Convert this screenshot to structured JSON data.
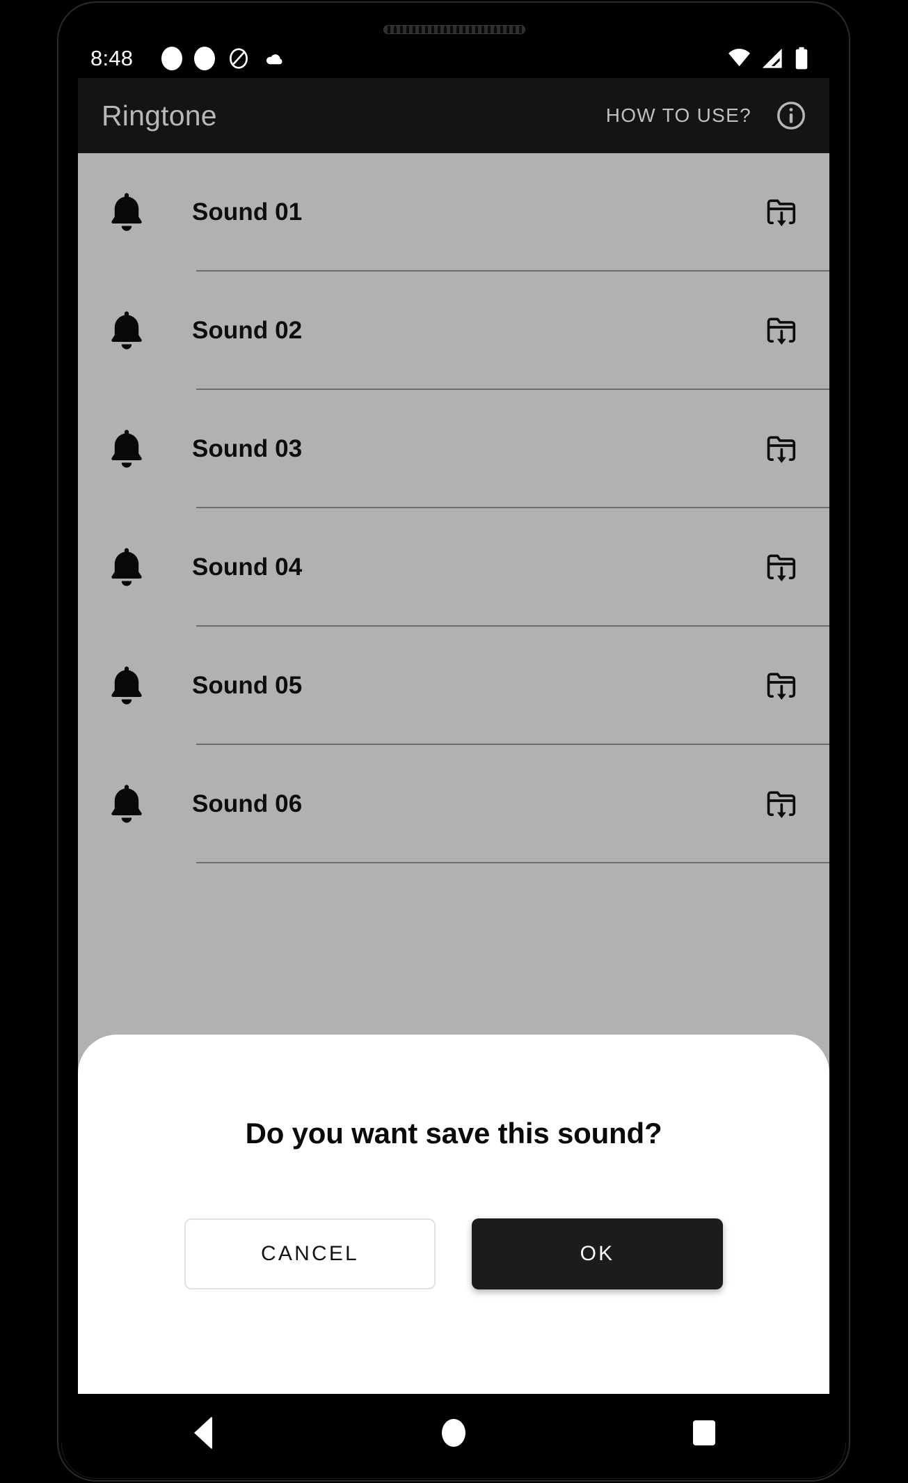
{
  "status_bar": {
    "clock": "8:48",
    "left_icons": [
      "notification-dot-icon",
      "notification-dot-icon",
      "android-q-icon",
      "cloud-icon"
    ],
    "right_icons": [
      "wifi-icon",
      "cellular-signal-icon",
      "battery-full-icon"
    ]
  },
  "app_bar": {
    "title": "Ringtone",
    "how_to_use_label": "HOW TO USE?",
    "info_icon": "info-circle-icon",
    "background_color": "#141414",
    "text_color": "#b8b8b8"
  },
  "sound_list": {
    "item_icon": "bell-icon",
    "save_icon": "folder-download-icon",
    "items": [
      {
        "label": "Sound 01"
      },
      {
        "label": "Sound 02"
      },
      {
        "label": "Sound 03"
      },
      {
        "label": "Sound 04"
      },
      {
        "label": "Sound 05"
      },
      {
        "label": "Sound 06"
      }
    ]
  },
  "dialog": {
    "title": "Do you want save this sound?",
    "cancel_label": "CANCEL",
    "ok_label": "OK",
    "ok_background_color": "#1c1c1c",
    "ok_text_color": "#ffffff",
    "cancel_border_color": "#e2e2e2",
    "surface_color": "#ffffff"
  },
  "nav_bar": {
    "back_icon": "triangle-back-icon",
    "home_icon": "circle-home-icon",
    "recents_icon": "square-recents-icon"
  },
  "theme": {
    "scrim_background": "#b1b1b1",
    "divider_color": "#6f6f6f",
    "list_text_color": "#0d0d0d"
  }
}
